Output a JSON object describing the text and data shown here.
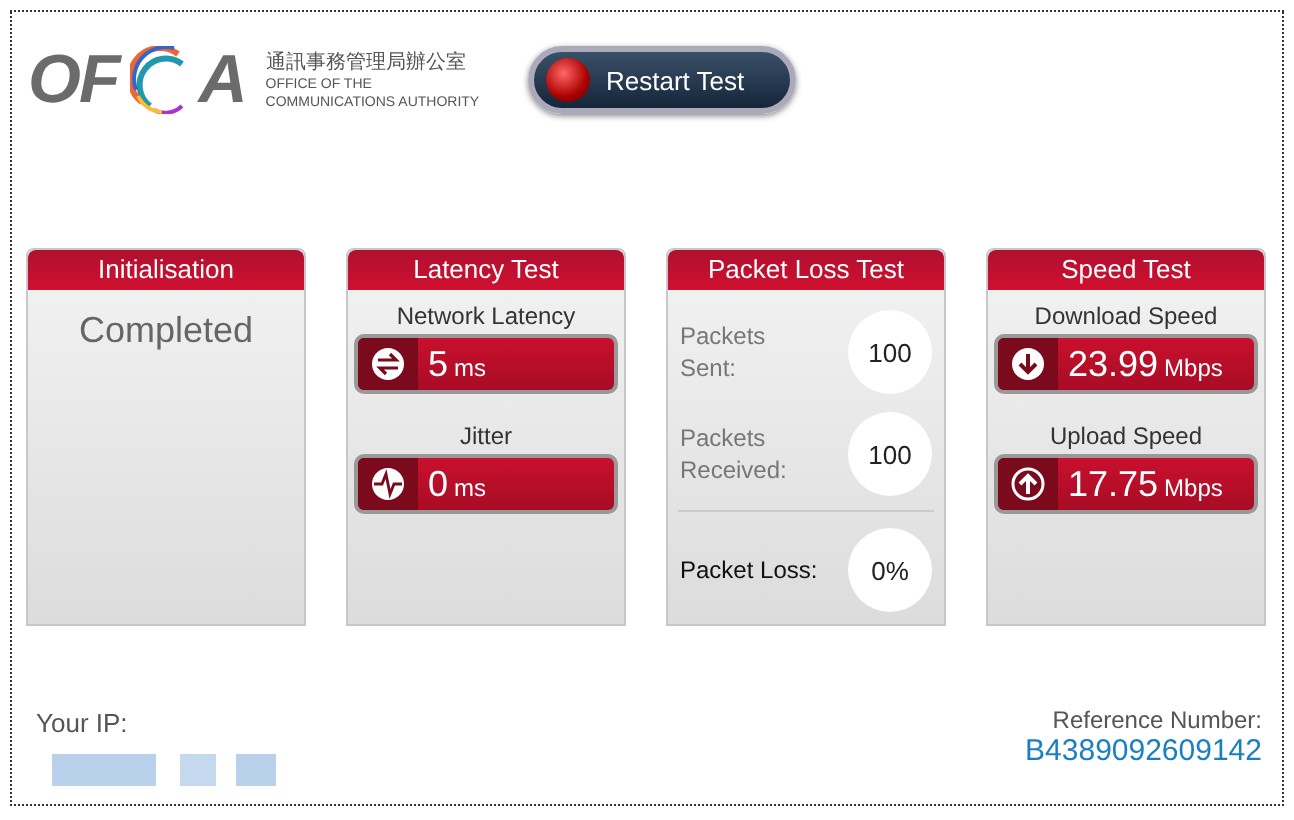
{
  "logo": {
    "left": "OF",
    "right": "A",
    "name_zh": "通訊事務管理局辦公室",
    "name_en": [
      "OFFICE OF THE",
      "COMMUNICATIONS AUTHORITY"
    ]
  },
  "restart_button": {
    "label": "Restart Test"
  },
  "panels": [
    {
      "kind": "status",
      "title": "Initialisation",
      "status": "Completed"
    },
    {
      "kind": "meters",
      "title": "Latency Test",
      "meters": [
        {
          "label": "Network Latency",
          "kind": "exchange",
          "value": "5",
          "unit": "ms"
        },
        {
          "label": "Jitter",
          "kind": "pulse",
          "value": "0",
          "unit": "ms"
        }
      ]
    },
    {
      "kind": "counts",
      "title": "Packet Loss Test",
      "counts": [
        {
          "label": "Packets Sent:",
          "value": "100"
        },
        {
          "label": "Packets Received:",
          "value": "100"
        }
      ],
      "total": {
        "label": "Packet Loss:",
        "value": "0%"
      }
    },
    {
      "kind": "meters",
      "title": "Speed Test",
      "meters": [
        {
          "label": "Download Speed",
          "kind": "down",
          "value": "23.99",
          "unit": "Mbps"
        },
        {
          "label": "Upload Speed",
          "kind": "up",
          "value": "17.75",
          "unit": "Mbps"
        }
      ]
    }
  ],
  "footer": {
    "ip_label": "Your IP:",
    "reference_label": "Reference Number:",
    "reference": "B4389092609142"
  }
}
